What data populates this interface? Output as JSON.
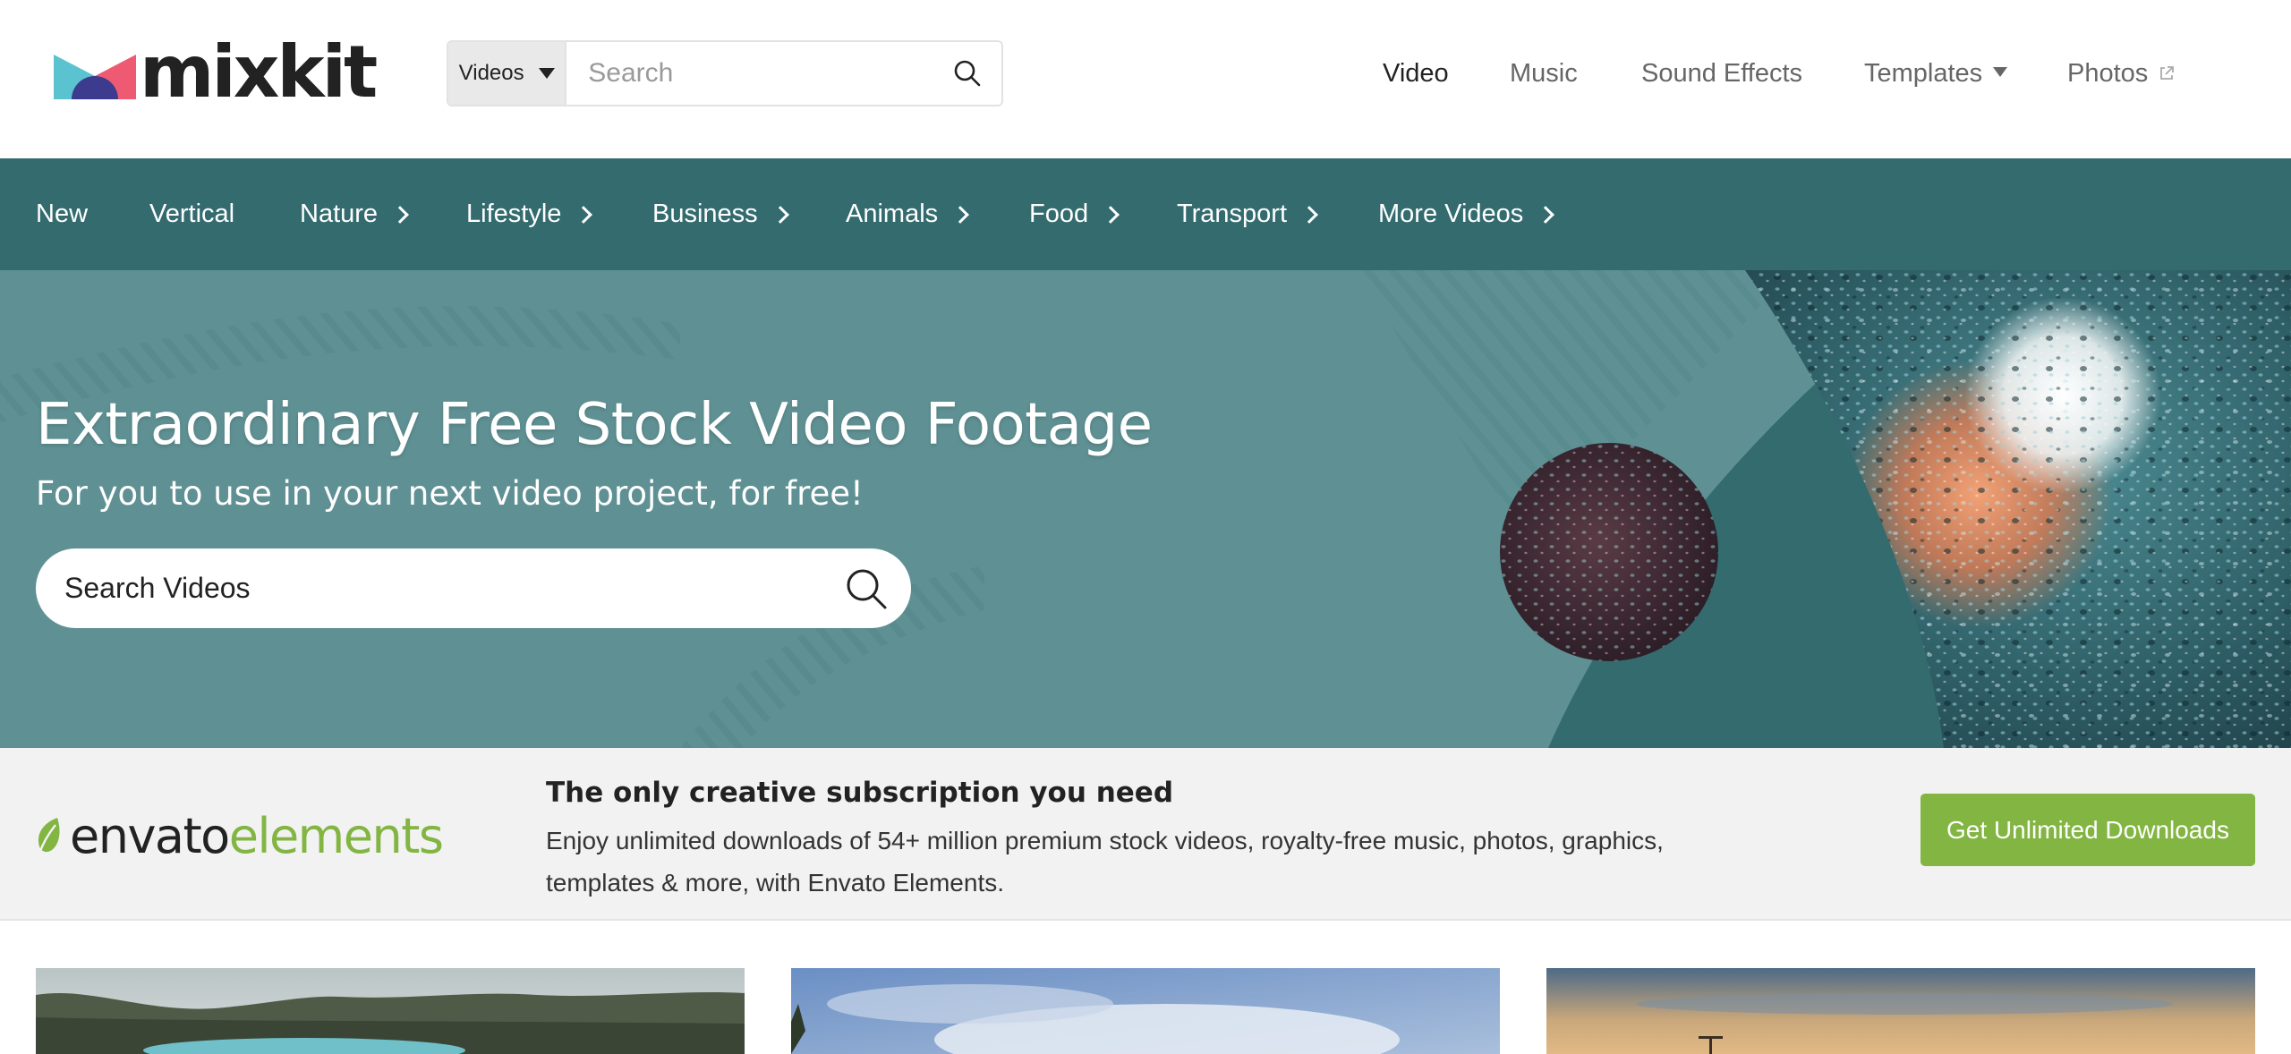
{
  "header": {
    "logo_text": "mixkit",
    "search": {
      "category": "Videos",
      "placeholder": "Search"
    },
    "nav": [
      {
        "label": "Video",
        "active": true,
        "icon": ""
      },
      {
        "label": "Music",
        "active": false,
        "icon": ""
      },
      {
        "label": "Sound Effects",
        "active": false,
        "icon": ""
      },
      {
        "label": "Templates",
        "active": false,
        "icon": "caret-down-icon"
      },
      {
        "label": "Photos",
        "active": false,
        "icon": "external-link-icon"
      }
    ]
  },
  "categories": [
    {
      "label": "New",
      "has_submenu": false
    },
    {
      "label": "Vertical",
      "has_submenu": false
    },
    {
      "label": "Nature",
      "has_submenu": true
    },
    {
      "label": "Lifestyle",
      "has_submenu": true
    },
    {
      "label": "Business",
      "has_submenu": true
    },
    {
      "label": "Animals",
      "has_submenu": true
    },
    {
      "label": "Food",
      "has_submenu": true
    },
    {
      "label": "Transport",
      "has_submenu": true
    },
    {
      "label": "More Videos",
      "has_submenu": true
    }
  ],
  "hero": {
    "title": "Extraordinary Free Stock Video Footage",
    "subtitle": "For you to use in your next video project, for free!",
    "search_placeholder": "Search Videos"
  },
  "promo": {
    "logo_part1": "envato",
    "logo_part2": "elements",
    "title": "The only creative subscription you need",
    "text": "Enjoy unlimited downloads of 54+ million premium stock videos, royalty-free music, photos, graphics, templates & more, with Envato Elements.",
    "button_label": "Get Unlimited Downloads"
  },
  "colors": {
    "brand_dark": "#222222",
    "category_bar": "#336b6f",
    "hero_bg": "#5f9194",
    "envato_green": "#82b541"
  }
}
